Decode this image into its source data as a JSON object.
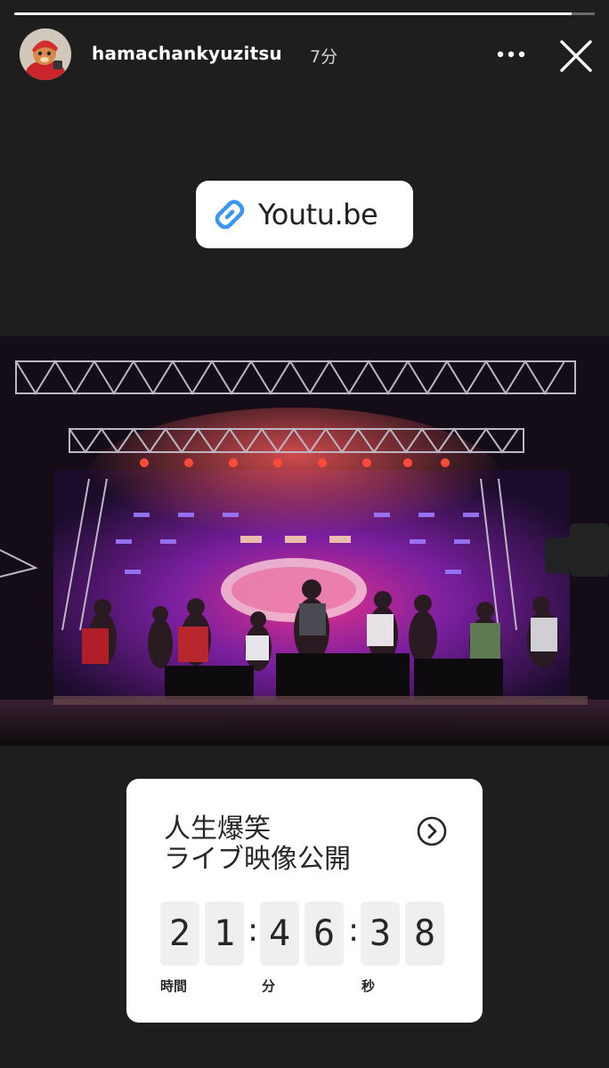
{
  "story": {
    "username": "hamachankyuzitsu",
    "timestamp": "7分",
    "progress": 0.96
  },
  "link_sticker": {
    "label": "Youtu.be",
    "icon": "link-icon"
  },
  "countdown": {
    "title_line1": "人生爆笑",
    "title_line2": "ライブ映像公開",
    "hours": [
      "2",
      "1"
    ],
    "minutes": [
      "4",
      "6"
    ],
    "seconds": [
      "3",
      "8"
    ],
    "labels": {
      "hours": "時間",
      "minutes": "分",
      "seconds": "秒"
    },
    "colon": ":",
    "arrow_icon": "chevron-right-circle-icon"
  },
  "icons": {
    "more": "more-horizontal-icon",
    "close": "close-icon"
  },
  "colors": {
    "background": "#1e1e1e",
    "link_blue": "#3897f0",
    "card": "#ffffff",
    "digit_bg": "#efefef"
  }
}
